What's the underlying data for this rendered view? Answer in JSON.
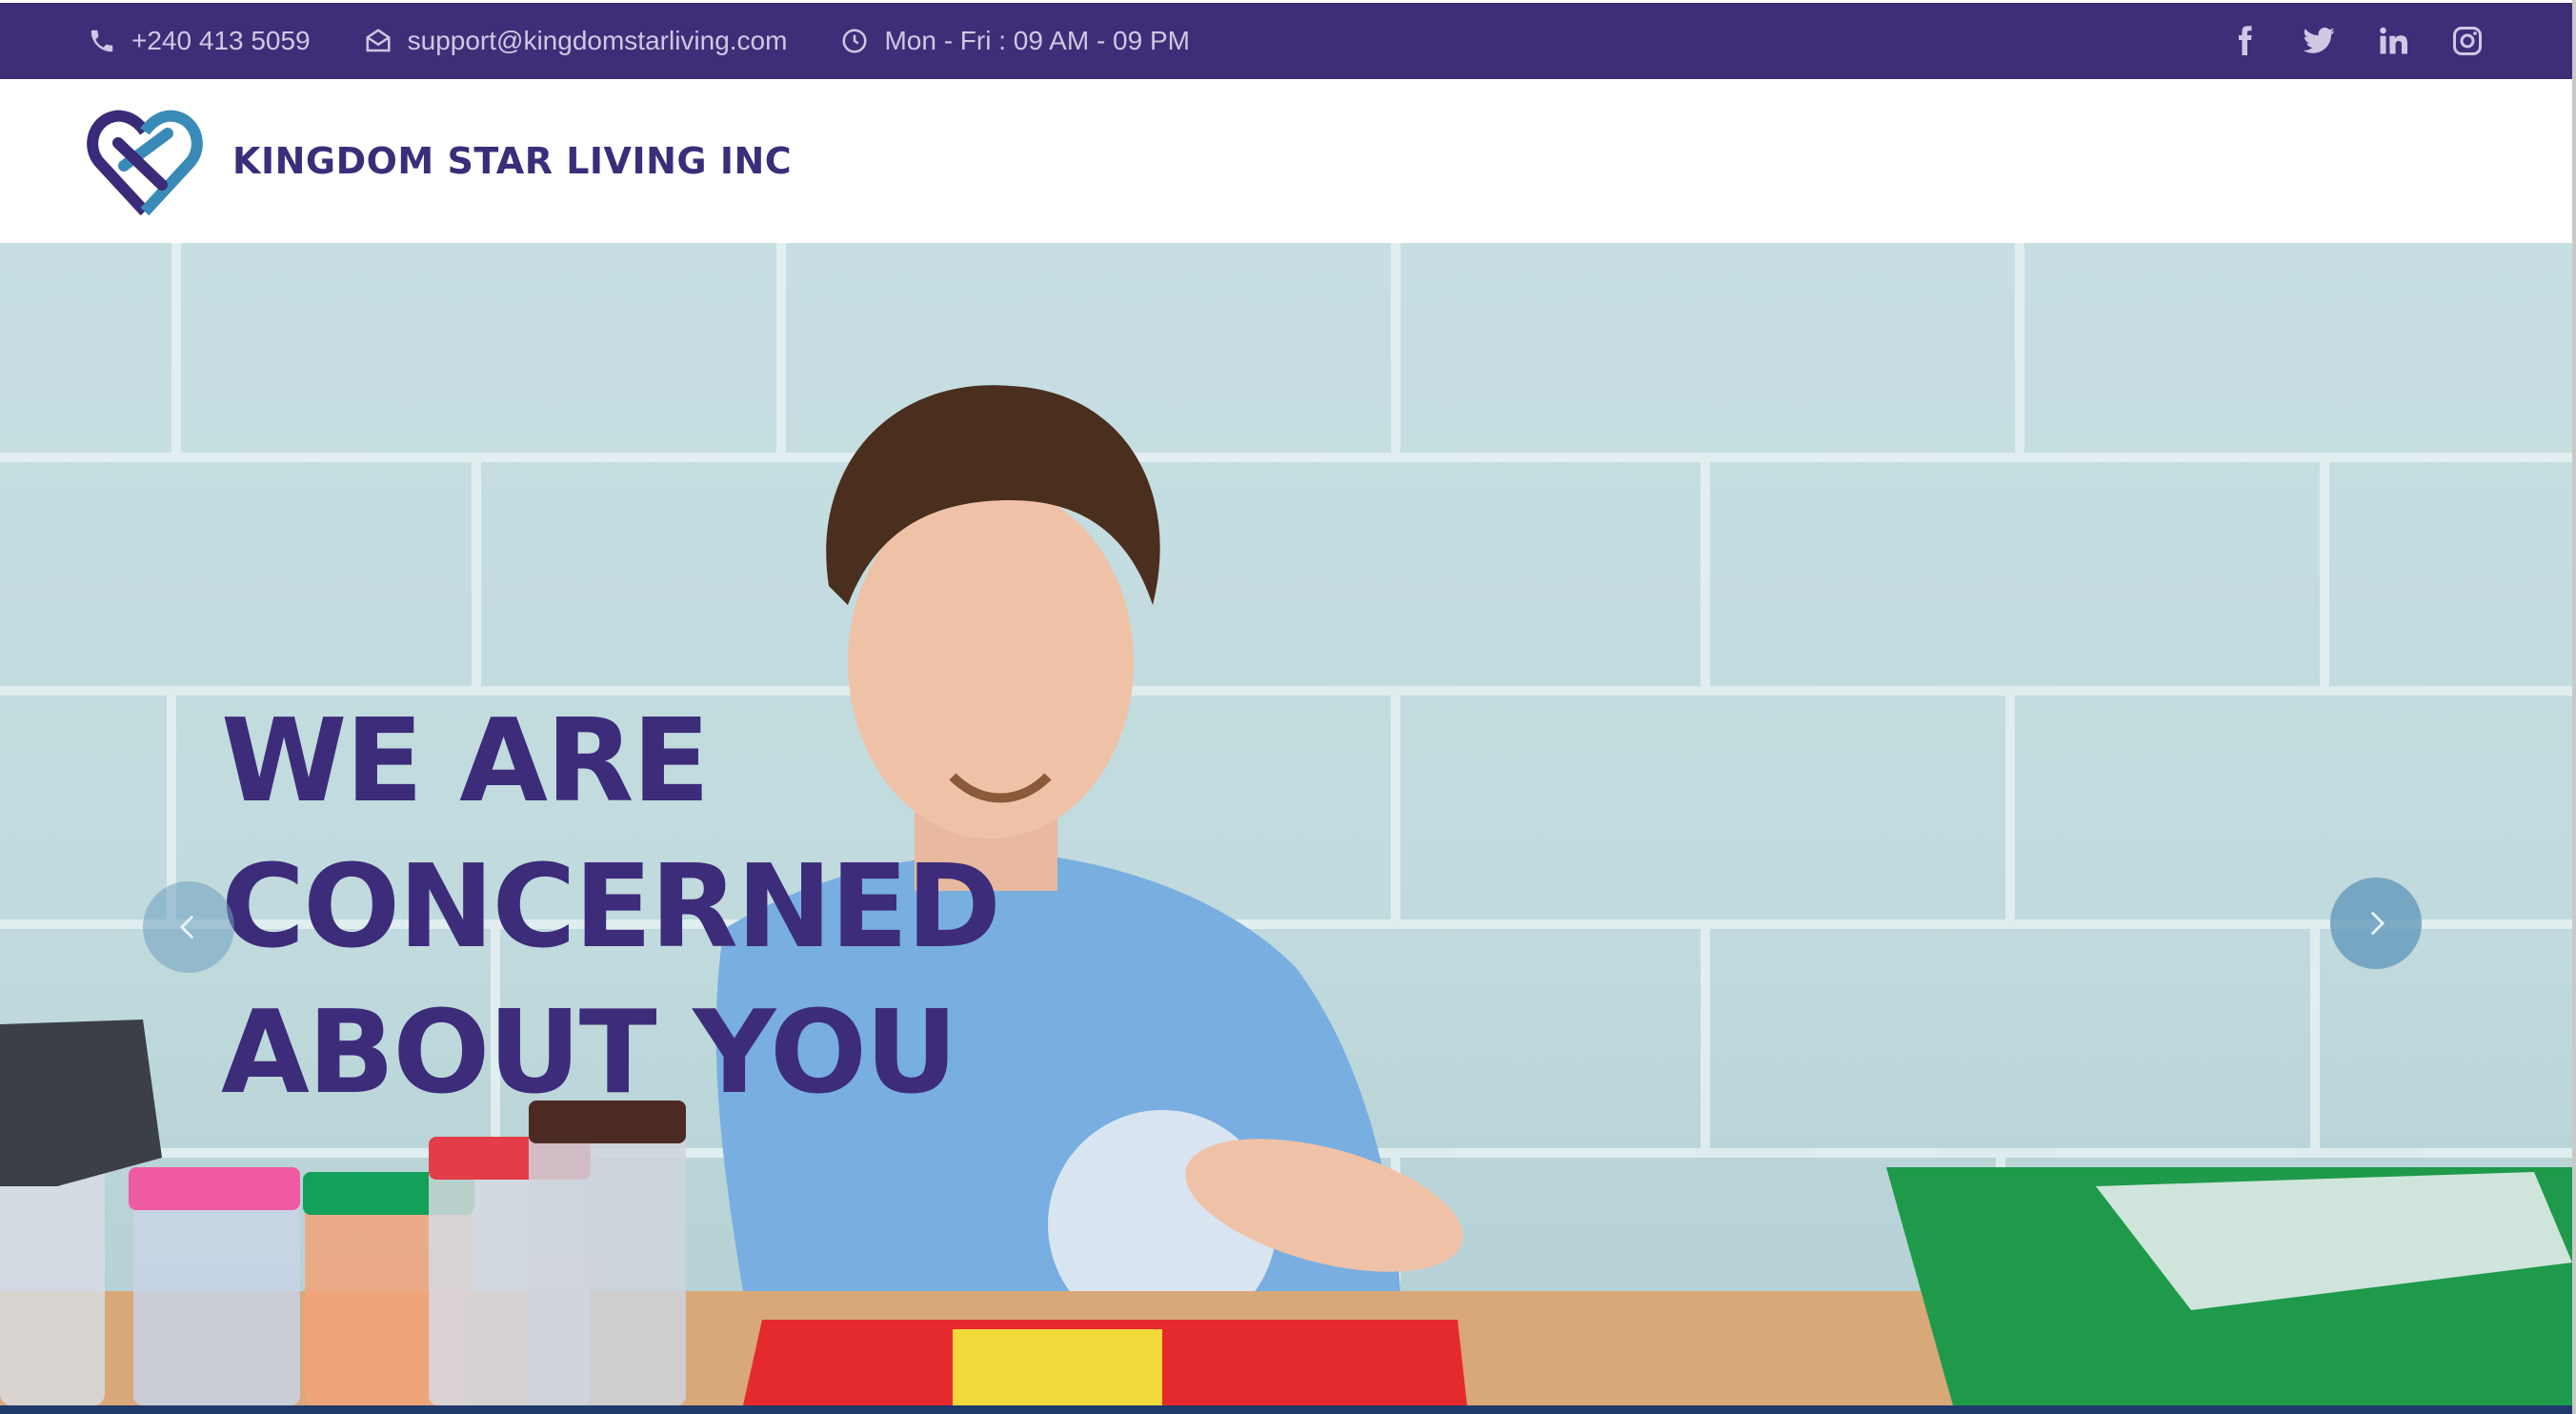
{
  "topbar": {
    "phone": "+240 413 5059",
    "email": "support@kingdomstarliving.com",
    "hours": "Mon - Fri : 09 AM - 09 PM",
    "icons": [
      "phone-icon",
      "mail-icon",
      "clock-icon"
    ],
    "social": [
      "facebook-icon",
      "twitter-icon",
      "linkedin-icon",
      "instagram-icon"
    ]
  },
  "header": {
    "brand": "KINGDOM STAR LIVING INC",
    "logo": "heart-logo"
  },
  "hero": {
    "title_lines": [
      "WE ARE",
      "CONCERNED",
      "ABOUT YOU"
    ],
    "prev_icon": "chevron-left-icon",
    "next_icon": "chevron-right-icon"
  },
  "colors": {
    "topbar_bg": "#402d78",
    "brand_text": "#3b2d7a",
    "hero_title": "#3d2c7a",
    "logo_dark": "#3a2a78",
    "logo_light": "#3a8ab8",
    "arrow_bg": "#5c94b8"
  }
}
